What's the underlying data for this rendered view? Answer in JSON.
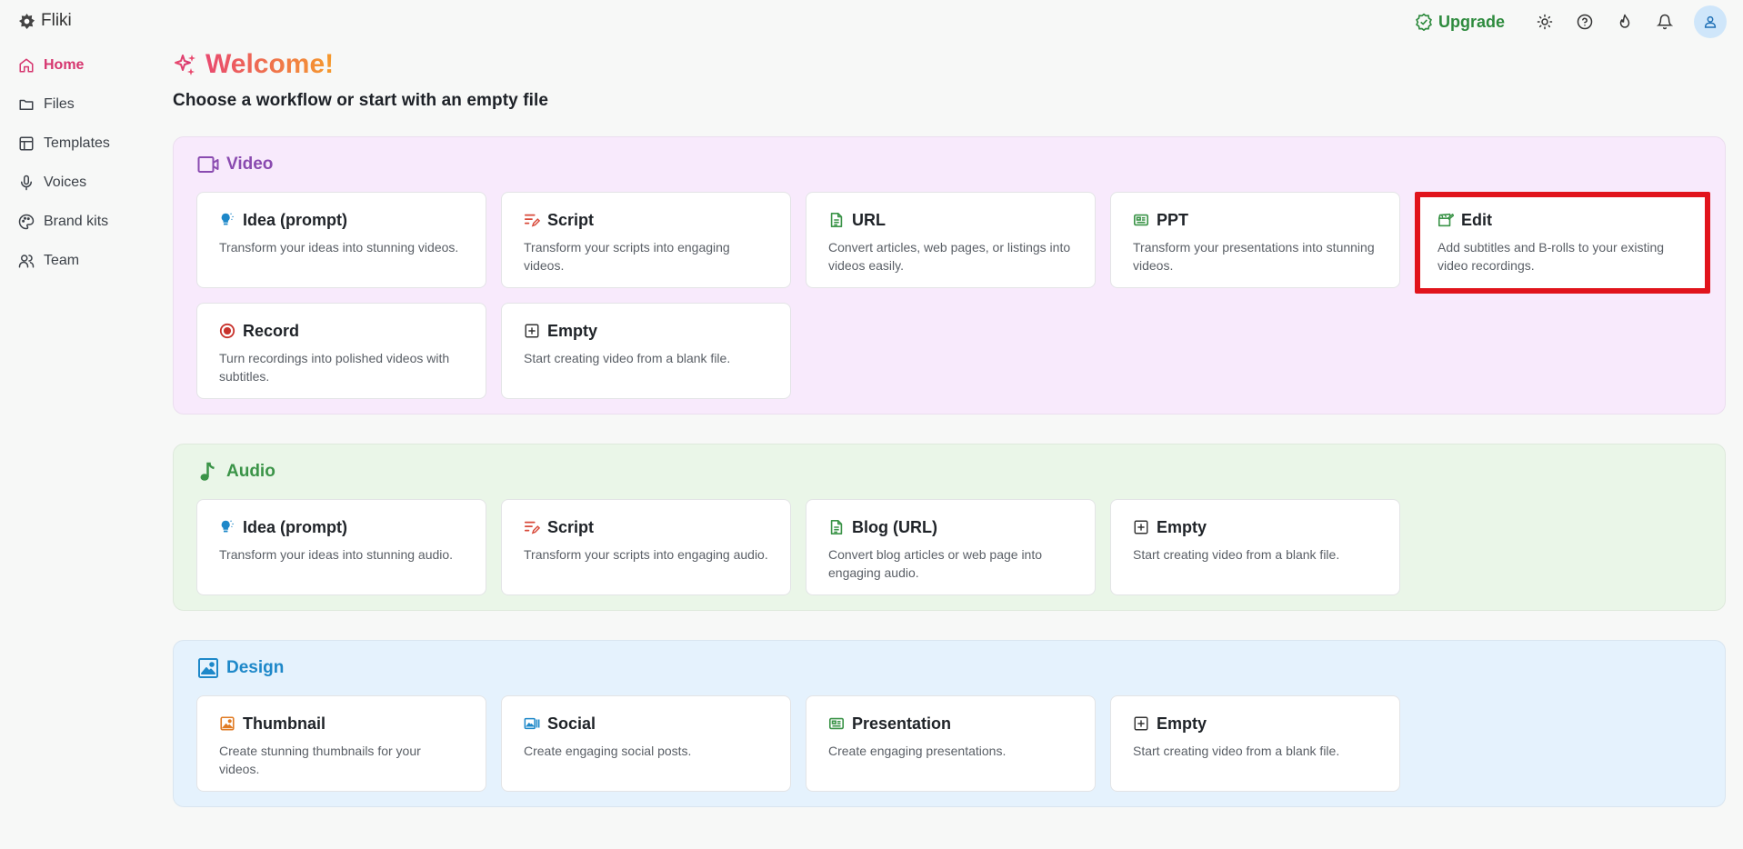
{
  "app": {
    "name": "Fliki"
  },
  "topbar": {
    "upgrade_label": "Upgrade"
  },
  "sidebar": {
    "items": [
      {
        "label": "Home"
      },
      {
        "label": "Files"
      },
      {
        "label": "Templates"
      },
      {
        "label": "Voices"
      },
      {
        "label": "Brand kits"
      },
      {
        "label": "Team"
      }
    ]
  },
  "main": {
    "welcome": "Welcome!",
    "subtitle": "Choose a workflow or start with an empty file",
    "sections": {
      "video": {
        "title": "Video",
        "cards": [
          {
            "title": "Idea (prompt)",
            "desc": "Transform your ideas into stunning videos."
          },
          {
            "title": "Script",
            "desc": "Transform your scripts into engaging videos."
          },
          {
            "title": "URL",
            "desc": "Convert articles, web pages, or listings into videos easily."
          },
          {
            "title": "PPT",
            "desc": "Transform your presentations into stunning videos."
          },
          {
            "title": "Edit",
            "desc": "Add subtitles and B-rolls to your existing video recordings."
          },
          {
            "title": "Record",
            "desc": "Turn recordings into polished videos with subtitles."
          },
          {
            "title": "Empty",
            "desc": "Start creating video from a blank file."
          }
        ]
      },
      "audio": {
        "title": "Audio",
        "cards": [
          {
            "title": "Idea (prompt)",
            "desc": "Transform your ideas into stunning audio."
          },
          {
            "title": "Script",
            "desc": "Transform your scripts into engaging audio."
          },
          {
            "title": "Blog (URL)",
            "desc": "Convert blog articles or web page into engaging audio."
          },
          {
            "title": "Empty",
            "desc": "Start creating video from a blank file."
          }
        ]
      },
      "design": {
        "title": "Design",
        "cards": [
          {
            "title": "Thumbnail",
            "desc": "Create stunning thumbnails for your videos."
          },
          {
            "title": "Social",
            "desc": "Create engaging social posts."
          },
          {
            "title": "Presentation",
            "desc": "Create engaging presentations."
          },
          {
            "title": "Empty",
            "desc": "Start creating video from a blank file."
          }
        ]
      }
    }
  },
  "colors": {
    "accent_pink": "#d6366f",
    "upgrade_green": "#2e8b3e",
    "video_bg": "#f8eafc",
    "audio_bg": "#eaf6e8",
    "design_bg": "#e5f2fd",
    "highlight_red": "#e1141c"
  }
}
